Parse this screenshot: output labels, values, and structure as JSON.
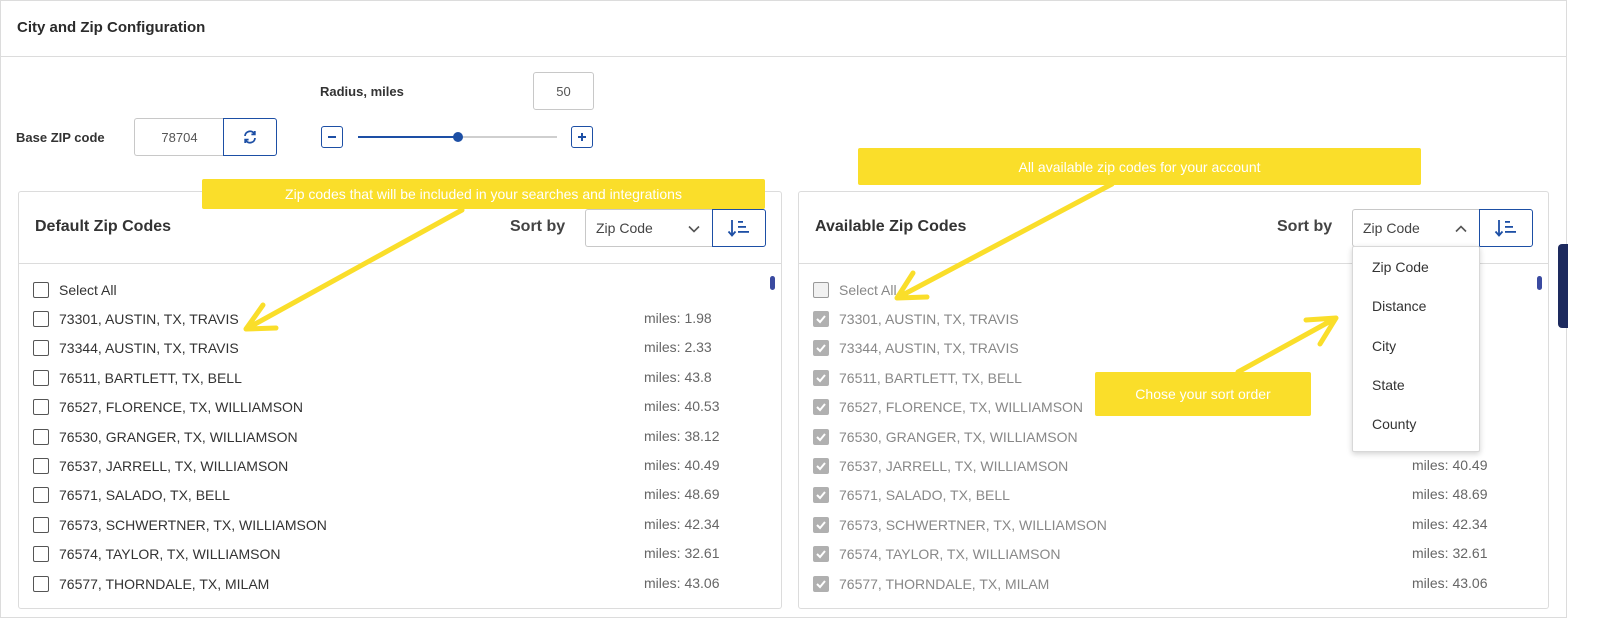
{
  "page": {
    "title": "City and Zip Configuration"
  },
  "base_zip": {
    "label": "Base ZIP code",
    "value": "78704"
  },
  "radius": {
    "label": "Radius, miles",
    "value": "50",
    "level_fraction": 0.5
  },
  "left_panel": {
    "title": "Default Zip Codes",
    "sort_label": "Sort by",
    "sort_value": "Zip Code",
    "select_all": "Select All",
    "rows": [
      {
        "label": "73301, AUSTIN, TX, TRAVIS",
        "miles": "miles: 1.98"
      },
      {
        "label": "73344, AUSTIN, TX, TRAVIS",
        "miles": "miles: 2.33"
      },
      {
        "label": "76511, BARTLETT, TX, BELL",
        "miles": "miles: 43.8"
      },
      {
        "label": "76527, FLORENCE, TX, WILLIAMSON",
        "miles": "miles: 40.53"
      },
      {
        "label": "76530, GRANGER, TX, WILLIAMSON",
        "miles": "miles: 38.12"
      },
      {
        "label": "76537, JARRELL, TX, WILLIAMSON",
        "miles": "miles: 40.49"
      },
      {
        "label": "76571, SALADO, TX, BELL",
        "miles": "miles: 48.69"
      },
      {
        "label": "76573, SCHWERTNER, TX, WILLIAMSON",
        "miles": "miles: 42.34"
      },
      {
        "label": "76574, TAYLOR, TX, WILLIAMSON",
        "miles": "miles: 32.61"
      },
      {
        "label": "76577, THORNDALE, TX, MILAM",
        "miles": "miles: 43.06"
      }
    ]
  },
  "right_panel": {
    "title": "Available Zip Codes",
    "sort_label": "Sort by",
    "sort_value": "Zip Code",
    "select_all": "Select All",
    "rows": [
      {
        "label": "73301, AUSTIN, TX, TRAVIS",
        "miles": ""
      },
      {
        "label": "73344, AUSTIN, TX, TRAVIS",
        "miles": ""
      },
      {
        "label": "76511, BARTLETT, TX, BELL",
        "miles": ""
      },
      {
        "label": "76527, FLORENCE, TX, WILLIAMSON",
        "miles": ""
      },
      {
        "label": "76530, GRANGER, TX, WILLIAMSON",
        "miles": ""
      },
      {
        "label": "76537, JARRELL, TX, WILLIAMSON",
        "miles": "miles: 40.49"
      },
      {
        "label": "76571, SALADO, TX, BELL",
        "miles": "miles: 48.69"
      },
      {
        "label": "76573, SCHWERTNER, TX, WILLIAMSON",
        "miles": "miles: 42.34"
      },
      {
        "label": "76574, TAYLOR, TX, WILLIAMSON",
        "miles": "miles: 32.61"
      },
      {
        "label": "76577, THORNDALE, TX, MILAM",
        "miles": "miles: 43.06"
      }
    ]
  },
  "sort_dropdown": {
    "options": [
      "Zip Code",
      "Distance",
      "City",
      "State",
      "County"
    ]
  },
  "callouts": {
    "default_zip": "Zip codes that will be included in your searches and integrations",
    "available_zip": "All available zip codes for your account",
    "sort_order": "Chose your sort order"
  },
  "colors": {
    "accent": "#1d4fa5",
    "callout": "#fade2a",
    "border": "#dcdcdc"
  },
  "icons": {
    "refresh": "refresh-icon",
    "minus": "minus-icon",
    "plus": "plus-icon",
    "sort": "sort-ascending-icon",
    "chevron": "chevron-icon"
  }
}
